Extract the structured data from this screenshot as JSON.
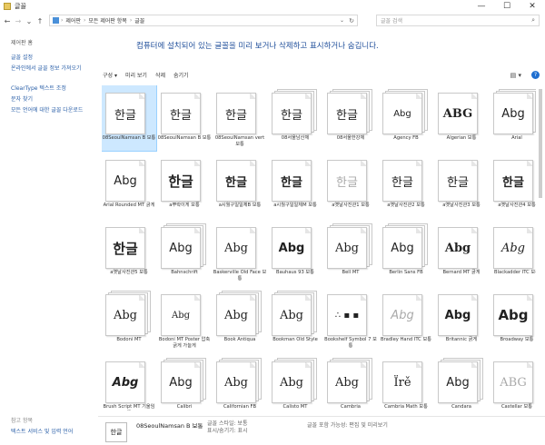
{
  "window": {
    "title": "글꼴",
    "minimize": "—",
    "maximize": "☐",
    "close": "✕"
  },
  "nav": {
    "back": "←",
    "forward": "→",
    "recent": "⌄",
    "up": "↑"
  },
  "address": {
    "segments": [
      "제어판",
      "모든 제어판 항목",
      "글꼴"
    ],
    "separator": "›",
    "dropdown": "⌄",
    "refresh": "↻"
  },
  "search": {
    "placeholder": "글꼴 검색",
    "icon": "search-icon"
  },
  "sidebar": {
    "home": "제어판 홈",
    "links": [
      "글꼴 설정",
      "온라인에서 글꼴 정보 가져오기",
      "ClearType 텍스트 조정",
      "문자 찾기",
      "모든 언어에 대한 글꼴 다운로드"
    ],
    "see_also_title": "참고 항목",
    "see_also": [
      "텍스트 서비스 및 입력 언어"
    ]
  },
  "heading": "컴퓨터에 설치되어 있는 글꼴을 미리 보거나 삭제하고 표시하거나 숨깁니다.",
  "toolbar": {
    "organize": "구성 ▾",
    "preview": "미리 보기",
    "delete": "삭제",
    "hide": "숨기기",
    "view": "▤ ▾",
    "help": "?"
  },
  "fonts": [
    {
      "name": "08SeoulNamsan B 보통",
      "sample": "한글",
      "style": "",
      "stack": 1,
      "selected": true
    },
    {
      "name": "08SeoulNamsan B 보통",
      "sample": "한글",
      "style": "",
      "stack": 1,
      "selected": false
    },
    {
      "name": "08SeoulNamsan vert 보통",
      "sample": "한글",
      "style": "",
      "stack": 1,
      "selected": false
    },
    {
      "name": "08서울남산체",
      "sample": "한글",
      "style": "",
      "stack": 3,
      "selected": false
    },
    {
      "name": "08서울한강체",
      "sample": "한글",
      "style": "",
      "stack": 3,
      "selected": false
    },
    {
      "name": "Agency FB",
      "sample": "Abg",
      "style": "small",
      "stack": 3,
      "selected": false
    },
    {
      "name": "Algerian 보통",
      "sample": "ABG",
      "style": "serif bold",
      "stack": 1,
      "selected": false
    },
    {
      "name": "Arial",
      "sample": "Abg",
      "style": "",
      "stack": 3,
      "selected": false
    },
    {
      "name": "Arial Rounded MT 굵게",
      "sample": "Abg",
      "style": "",
      "stack": 1,
      "selected": false
    },
    {
      "name": "a뿌락이게 보통",
      "sample": "한글",
      "style": "heavy",
      "stack": 1,
      "selected": false
    },
    {
      "name": "a시월구일일체B 보통",
      "sample": "한글",
      "style": "bold",
      "stack": 1,
      "selected": false
    },
    {
      "name": "a시월구일일체M 보통",
      "sample": "한글",
      "style": "bold",
      "stack": 1,
      "selected": false
    },
    {
      "name": "a옛날사진관1 보통",
      "sample": "한글",
      "style": "light",
      "stack": 1,
      "selected": false
    },
    {
      "name": "a옛날사진관2 보통",
      "sample": "한글",
      "style": "",
      "stack": 1,
      "selected": false
    },
    {
      "name": "a옛날사진관3 보통",
      "sample": "한글",
      "style": "",
      "stack": 1,
      "selected": false
    },
    {
      "name": "a옛날사진관4 보통",
      "sample": "한글",
      "style": "bold",
      "stack": 1,
      "selected": false
    },
    {
      "name": "a옛날사진관5 보통",
      "sample": "한글",
      "style": "heavy",
      "stack": 1,
      "selected": false
    },
    {
      "name": "Bahnschrift",
      "sample": "Abg",
      "style": "",
      "stack": 3,
      "selected": false
    },
    {
      "name": "Baskerville Old Face 보통",
      "sample": "Abg",
      "style": "serif",
      "stack": 1,
      "selected": false
    },
    {
      "name": "Bauhaus 93 보통",
      "sample": "Abg",
      "style": "bold",
      "stack": 1,
      "selected": false
    },
    {
      "name": "Bell MT",
      "sample": "Abg",
      "style": "serif",
      "stack": 3,
      "selected": false
    },
    {
      "name": "Berlin Sans FB",
      "sample": "Abg",
      "style": "",
      "stack": 3,
      "selected": false
    },
    {
      "name": "Bernard MT 굵게",
      "sample": "Abg",
      "style": "serif bold",
      "stack": 1,
      "selected": false
    },
    {
      "name": "Blackadder ITC 보통",
      "sample": "Abg",
      "style": "serif italic",
      "stack": 1,
      "selected": false
    },
    {
      "name": "Bodoni MT",
      "sample": "Abg",
      "style": "serif",
      "stack": 3,
      "selected": false
    },
    {
      "name": "Bodoni MT Poster 압축 굵게 가늘게",
      "sample": "Abg",
      "style": "serif small",
      "stack": 1,
      "selected": false
    },
    {
      "name": "Book Antiqua",
      "sample": "Abg",
      "style": "serif",
      "stack": 3,
      "selected": false
    },
    {
      "name": "Bookman Old Style",
      "sample": "Abg",
      "style": "serif",
      "stack": 3,
      "selected": false
    },
    {
      "name": "Bookshelf Symbol 7 보통",
      "sample": "∴ ▪ ▪",
      "style": "small",
      "stack": 1,
      "selected": false
    },
    {
      "name": "Bradley Hand ITC 보통",
      "sample": "Abg",
      "style": "italic light",
      "stack": 1,
      "selected": false
    },
    {
      "name": "Britannic 굵게",
      "sample": "Abg",
      "style": "bold",
      "stack": 1,
      "selected": false
    },
    {
      "name": "Broadway 보통",
      "sample": "Abg",
      "style": "heavy",
      "stack": 1,
      "selected": false
    },
    {
      "name": "Brush Script MT 기울임꼴",
      "sample": "Abg",
      "style": "italic bold",
      "stack": 1,
      "selected": false
    },
    {
      "name": "Calibri",
      "sample": "Abg",
      "style": "",
      "stack": 3,
      "selected": false
    },
    {
      "name": "Californian FB",
      "sample": "Abg",
      "style": "serif",
      "stack": 3,
      "selected": false
    },
    {
      "name": "Calisto MT",
      "sample": "Abg",
      "style": "serif",
      "stack": 3,
      "selected": false
    },
    {
      "name": "Cambria",
      "sample": "Abg",
      "style": "serif",
      "stack": 3,
      "selected": false
    },
    {
      "name": "Cambria Math 보통",
      "sample": "Ïrě",
      "style": "serif",
      "stack": 1,
      "selected": false
    },
    {
      "name": "Candara",
      "sample": "Abg",
      "style": "",
      "stack": 3,
      "selected": false
    },
    {
      "name": "Castellar 보통",
      "sample": "ABG",
      "style": "serif light",
      "stack": 1,
      "selected": false
    }
  ],
  "details": {
    "thumb": "한글",
    "name": "08SeoulNamsan B 보통",
    "style_label": "글꼴 스타일: 보통",
    "show_hide": "표시/숨기기: 표시",
    "embed": "글꼴 포함 가능성: 편집 및 미리보기"
  }
}
